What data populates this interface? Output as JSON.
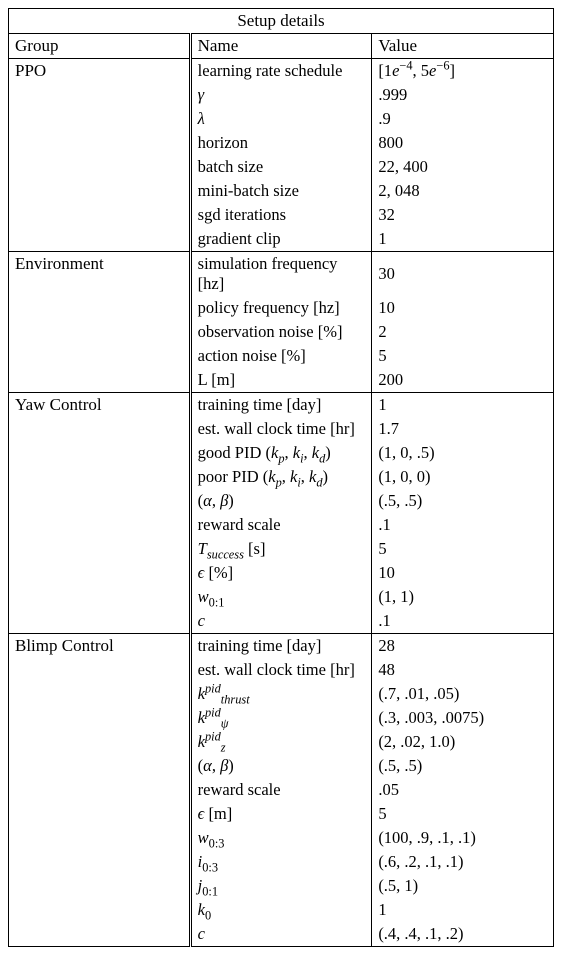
{
  "title": "Setup details",
  "headers": {
    "group": "Group",
    "name": "Name",
    "value": "Value"
  },
  "groups": [
    {
      "label": "PPO",
      "rows": [
        {
          "name_html": "learning rate schedule",
          "value_html": "[1<span class='ital'>e</span><sup>−4</sup>, 5<span class='ital'>e</span><sup>−6</sup>]"
        },
        {
          "name_html": "<span class='ital'>γ</span>",
          "value_html": ".999"
        },
        {
          "name_html": "<span class='ital'>λ</span>",
          "value_html": ".9"
        },
        {
          "name_html": "horizon",
          "value_html": "800"
        },
        {
          "name_html": "batch size",
          "value_html": "22, 400"
        },
        {
          "name_html": "mini-batch size",
          "value_html": "2, 048"
        },
        {
          "name_html": "sgd iterations",
          "value_html": "32"
        },
        {
          "name_html": "gradient clip",
          "value_html": "1"
        }
      ]
    },
    {
      "label": "Environment",
      "rows": [
        {
          "name_html": "simulation frequency [hz]",
          "value_html": "30"
        },
        {
          "name_html": "policy frequency [hz]",
          "value_html": "10"
        },
        {
          "name_html": "observation noise [%]",
          "value_html": "2"
        },
        {
          "name_html": "action noise [%]",
          "value_html": "5"
        },
        {
          "name_html": "L [m]",
          "value_html": "200"
        }
      ]
    },
    {
      "label": "Yaw Control",
      "rows": [
        {
          "name_html": "training time [day]",
          "value_html": "1"
        },
        {
          "name_html": "est. wall clock time [hr]",
          "value_html": "1.7"
        },
        {
          "name_html": "good PID (<span class='ital'>k<sub>p</sub></span>, <span class='ital'>k<sub>i</sub></span>, <span class='ital'>k<sub>d</sub></span>)",
          "value_html": "(1, 0, .5)"
        },
        {
          "name_html": "poor PID (<span class='ital'>k<sub>p</sub></span>, <span class='ital'>k<sub>i</sub></span>, <span class='ital'>k<sub>d</sub></span>)",
          "value_html": "(1, 0, 0)"
        },
        {
          "name_html": "(<span class='ital'>α</span>, <span class='ital'>β</span>)",
          "value_html": "(.5, .5)"
        },
        {
          "name_html": "reward scale",
          "value_html": ".1"
        },
        {
          "name_html": "<span class='ital'>T<sub>success</sub></span> [s]",
          "value_html": "5"
        },
        {
          "name_html": "<span class='ital'>ϵ</span> [%]",
          "value_html": "10"
        },
        {
          "name_html": "<span class='ital'>w</span><sub>0:1</sub>",
          "value_html": "(1, 1)"
        },
        {
          "name_html": "<span class='ital'>c</span>",
          "value_html": ".1"
        }
      ]
    },
    {
      "label": "Blimp Control",
      "rows": [
        {
          "name_html": "training time [day]",
          "value_html": "28"
        },
        {
          "name_html": "est. wall clock time [hr]",
          "value_html": "48"
        },
        {
          "name_html": "<span class='ital'>k</span><sup><span class='ital'>pid</span></sup><sub><span class='ital'>thrust</span></sub>",
          "value_html": "(.7, .01, .05)"
        },
        {
          "name_html": "<span class='ital'>k</span><sup><span class='ital'>pid</span></sup><sub><span class='ital'>ψ</span></sub>",
          "value_html": "(.3, .003, .0075)"
        },
        {
          "name_html": "<span class='ital'>k</span><sup><span class='ital'>pid</span></sup><sub><span class='ital'>z</span></sub>",
          "value_html": "(2, .02, 1.0)"
        },
        {
          "name_html": "(<span class='ital'>α</span>, <span class='ital'>β</span>)",
          "value_html": "(.5, .5)"
        },
        {
          "name_html": "reward scale",
          "value_html": ".05"
        },
        {
          "name_html": "<span class='ital'>ϵ</span> [m]",
          "value_html": "5"
        },
        {
          "name_html": "<span class='ital'>w</span><sub>0:3</sub>",
          "value_html": "(100, .9, .1, .1)"
        },
        {
          "name_html": "<span class='ital'>i</span><sub>0:3</sub>",
          "value_html": "(.6, .2, .1, .1)"
        },
        {
          "name_html": "<span class='ital'>j</span><sub>0:1</sub>",
          "value_html": "(.5, 1)"
        },
        {
          "name_html": "<span class='ital'>k</span><sub>0</sub>",
          "value_html": "1"
        },
        {
          "name_html": "<span class='ital'>c</span>",
          "value_html": "(.4, .4, .1, .2)"
        }
      ]
    }
  ]
}
